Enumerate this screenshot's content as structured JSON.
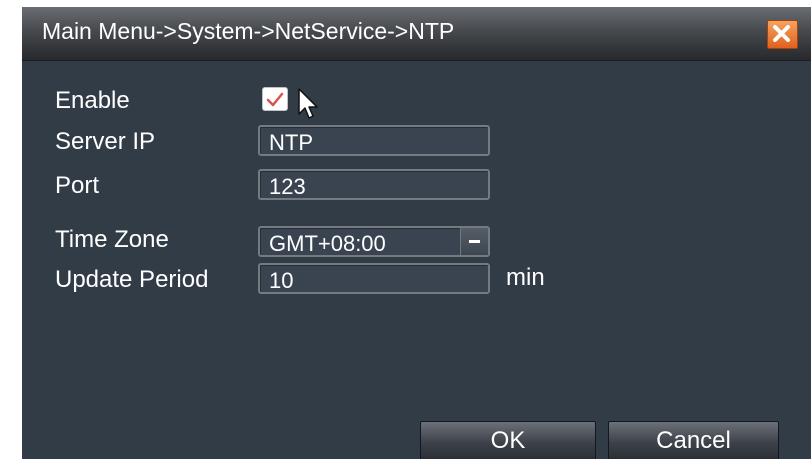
{
  "title": "Main Menu->System->NetService->NTP",
  "close": {
    "icon": "close-icon"
  },
  "fields": {
    "enable": {
      "label": "Enable",
      "checked": true
    },
    "server_ip": {
      "label": "Server IP",
      "value": "NTP"
    },
    "port": {
      "label": "Port",
      "value": "123"
    },
    "time_zone": {
      "label": "Time Zone",
      "value": "GMT+08:00"
    },
    "update_period": {
      "label": "Update Period",
      "value": "10",
      "unit": "min"
    }
  },
  "buttons": {
    "ok": "OK",
    "cancel": "Cancel"
  },
  "colors": {
    "dialog_bg": "#323c47",
    "close_button": "#e9762f",
    "checkmark": "#d9534f"
  }
}
